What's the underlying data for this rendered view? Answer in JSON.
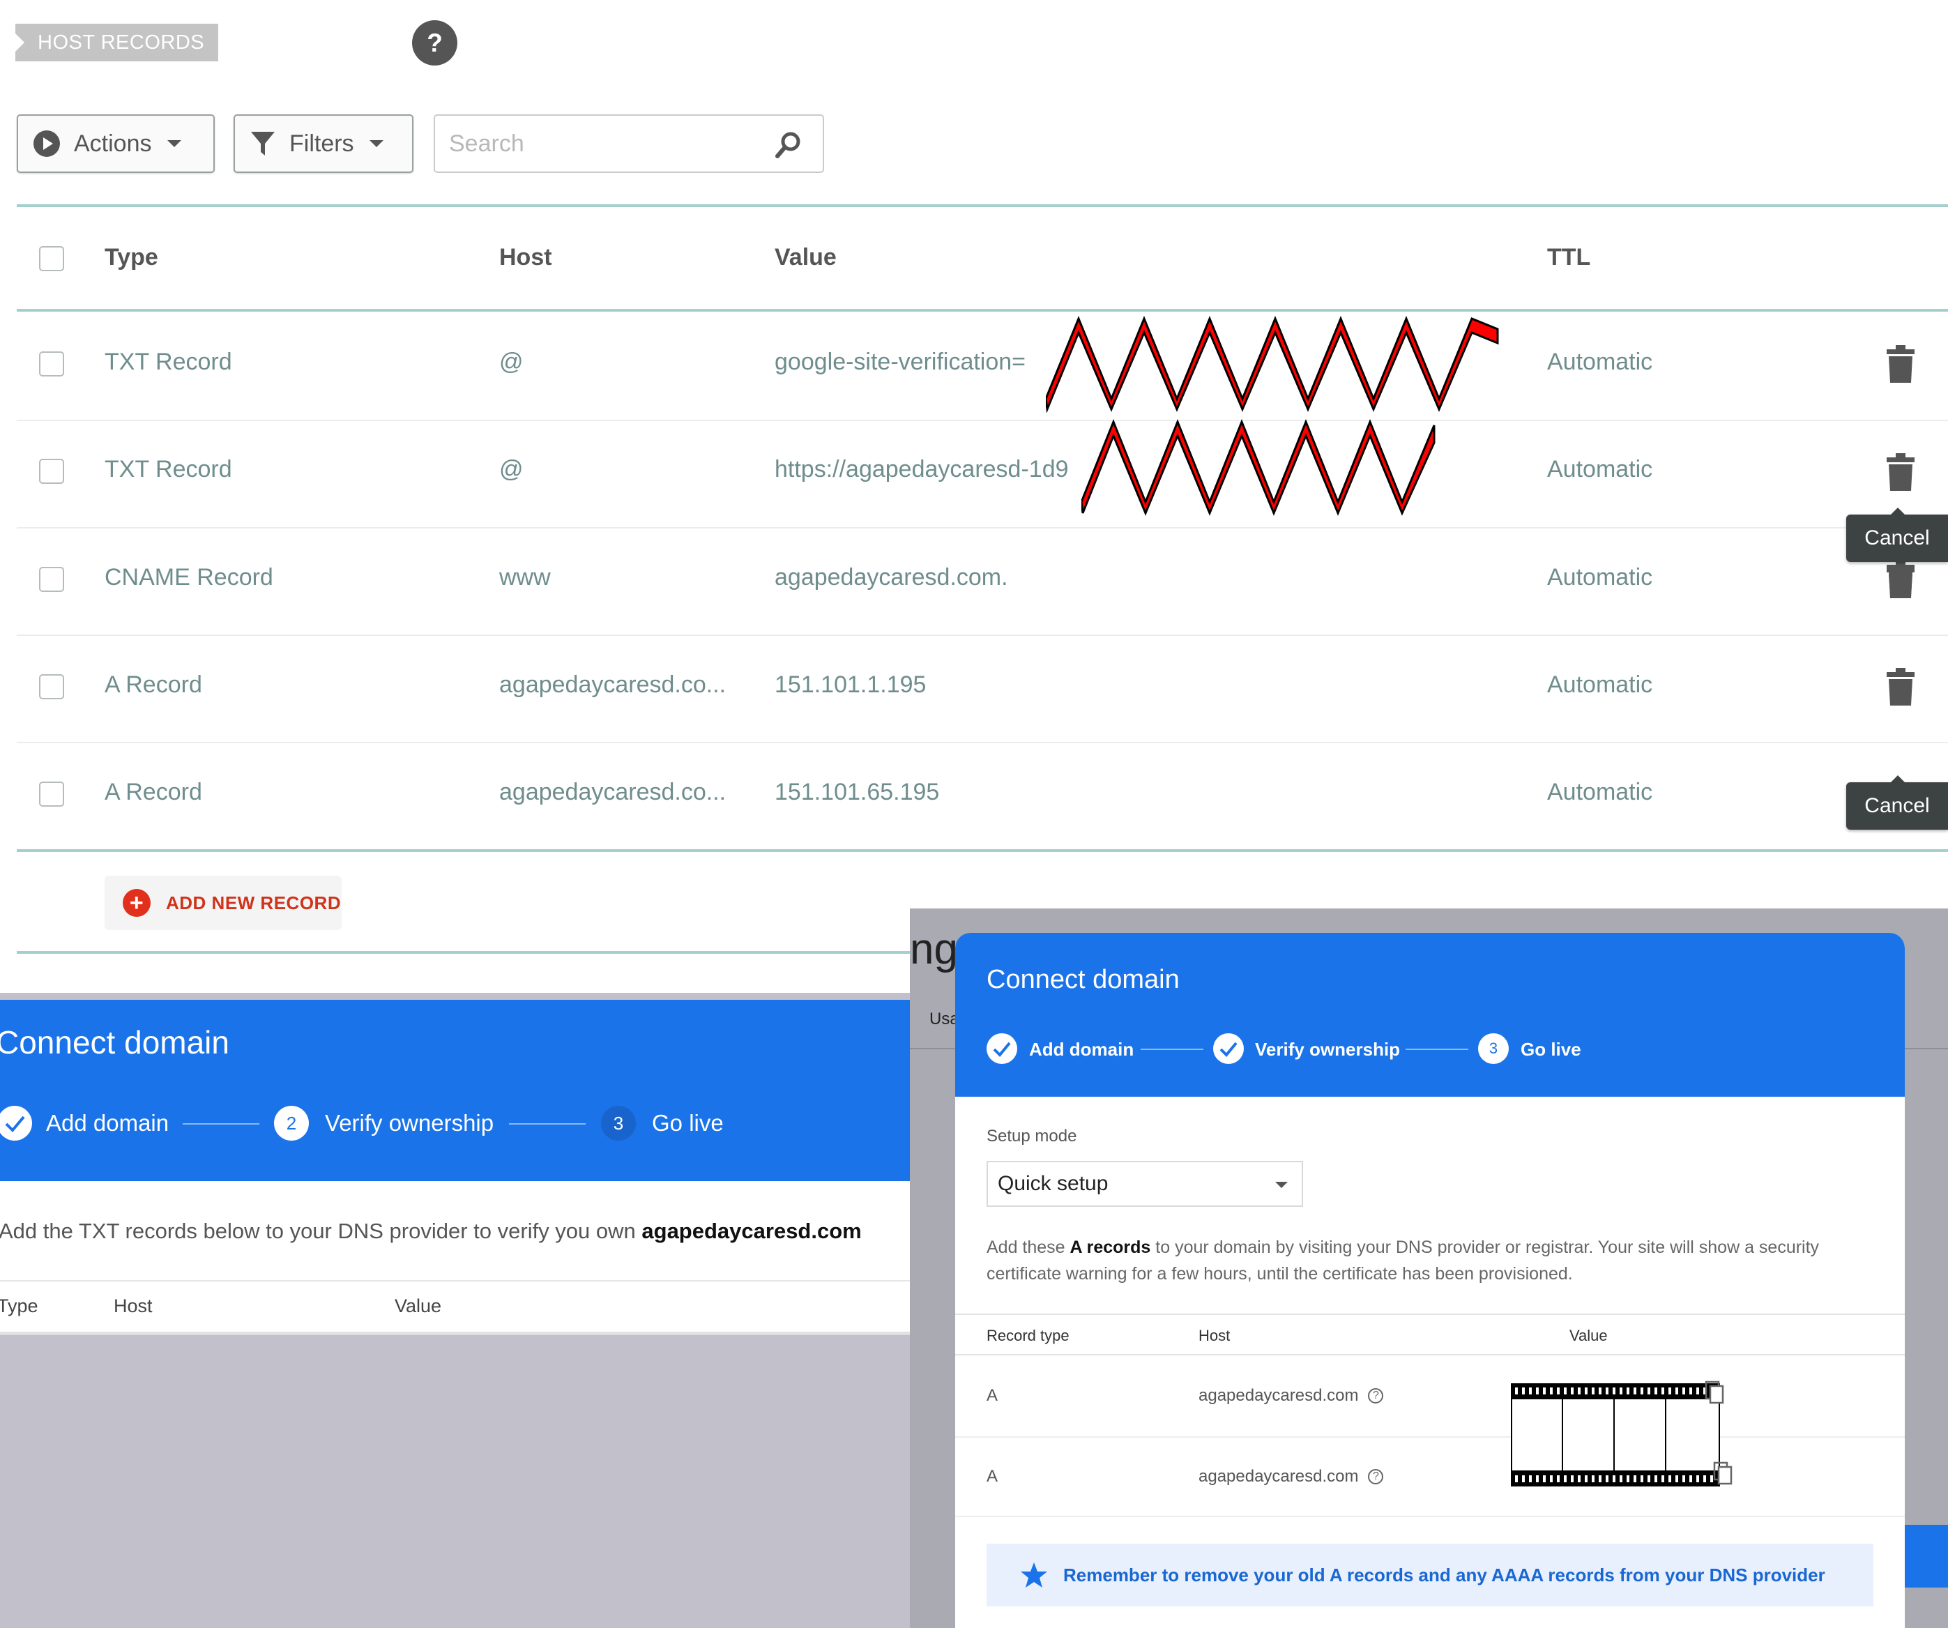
{
  "host_records": {
    "section_tag": "HOST RECORDS",
    "help_label": "?",
    "toolbar": {
      "actions_label": "Actions",
      "filters_label": "Filters",
      "search_placeholder": "Search"
    },
    "columns": [
      "Type",
      "Host",
      "Value",
      "TTL"
    ],
    "rows": [
      {
        "type": "TXT Record",
        "host": "@",
        "value": "google-site-verification=",
        "ttl": "Automatic"
      },
      {
        "type": "TXT Record",
        "host": "@",
        "value": "https://agapedaycaresd-1d9",
        "ttl": "Automatic"
      },
      {
        "type": "CNAME Record",
        "host": "www",
        "value": "agapedaycaresd.com.",
        "ttl": "Automatic"
      },
      {
        "type": "A Record",
        "host": "agapedaycaresd.co...",
        "value": "151.101.1.195",
        "ttl": "Automatic"
      },
      {
        "type": "A Record",
        "host": "agapedaycaresd.co...",
        "value": "151.101.65.195",
        "ttl": "Automatic"
      }
    ],
    "tooltip_cancel": "Cancel",
    "add_new_record": "ADD NEW RECORD",
    "redaction_color": "#ff0000"
  },
  "connect_left": {
    "title": "Connect domain",
    "steps": [
      {
        "label": "Add domain",
        "state": "done"
      },
      {
        "num": "2",
        "label": "Verify ownership",
        "state": "current"
      },
      {
        "num": "3",
        "label": "Go live",
        "state": "pending"
      }
    ],
    "instruction_prefix": "Add the TXT records below to your DNS provider to verify you own ",
    "instruction_domain": "agapedaycaresd.com",
    "columns": [
      "Type",
      "Host",
      "Value"
    ]
  },
  "connect_right": {
    "background_fragments": {
      "heading_partial": "ng",
      "tab_partial": "Usa"
    },
    "title": "Connect domain",
    "steps": [
      {
        "label": "Add domain",
        "state": "done"
      },
      {
        "label": "Verify ownership",
        "state": "done"
      },
      {
        "num": "3",
        "label": "Go live",
        "state": "current"
      }
    ],
    "setup_mode_label": "Setup mode",
    "setup_mode_value": "Quick setup",
    "instruction_pre": "Add these ",
    "instruction_bold": "A records",
    "instruction_post": " to your domain by visiting your DNS provider or registrar. Your site will show a security certificate warning for a few hours, until the certificate has been provisioned.",
    "columns": [
      "Record type",
      "Host",
      "Value"
    ],
    "rows": [
      {
        "type": "A",
        "host": "agapedaycaresd.com"
      },
      {
        "type": "A",
        "host": "agapedaycaresd.com"
      }
    ],
    "notice": "Remember to remove your old A records and any AAAA records from your DNS provider",
    "accent_color": "#1a73e8"
  }
}
